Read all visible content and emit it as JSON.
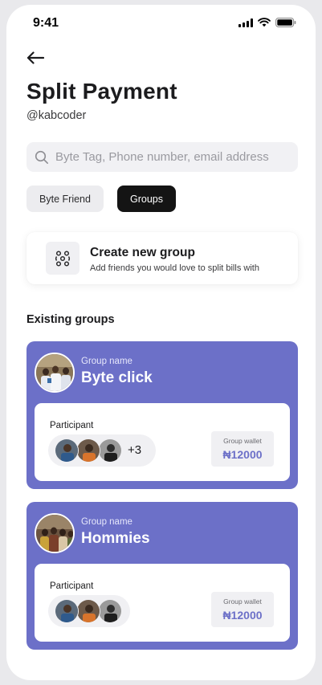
{
  "status_bar": {
    "time": "9:41"
  },
  "header": {
    "title": "Split Payment",
    "username": "@kabcoder"
  },
  "search": {
    "placeholder": "Byte Tag, Phone number, email address",
    "value": ""
  },
  "tabs": [
    {
      "label": "Byte Friend",
      "active": false
    },
    {
      "label": "Groups",
      "active": true
    }
  ],
  "create_group": {
    "title": "Create new group",
    "subtitle": "Add friends you would love to split bills with"
  },
  "existing_groups": {
    "title": "Existing groups",
    "groups": [
      {
        "name_label": "Group name",
        "name": "Byte click",
        "participant_label": "Participant",
        "more_count": "+3",
        "wallet_label": "Group wallet",
        "wallet_amount": "₦12000"
      },
      {
        "name_label": "Group name",
        "name": "Hommies",
        "participant_label": "Participant",
        "more_count": "",
        "wallet_label": "Group wallet",
        "wallet_amount": "₦12000"
      }
    ]
  },
  "colors": {
    "accent": "#6c70c8",
    "tab_active_bg": "#141414",
    "input_bg": "#f1f1f4"
  }
}
